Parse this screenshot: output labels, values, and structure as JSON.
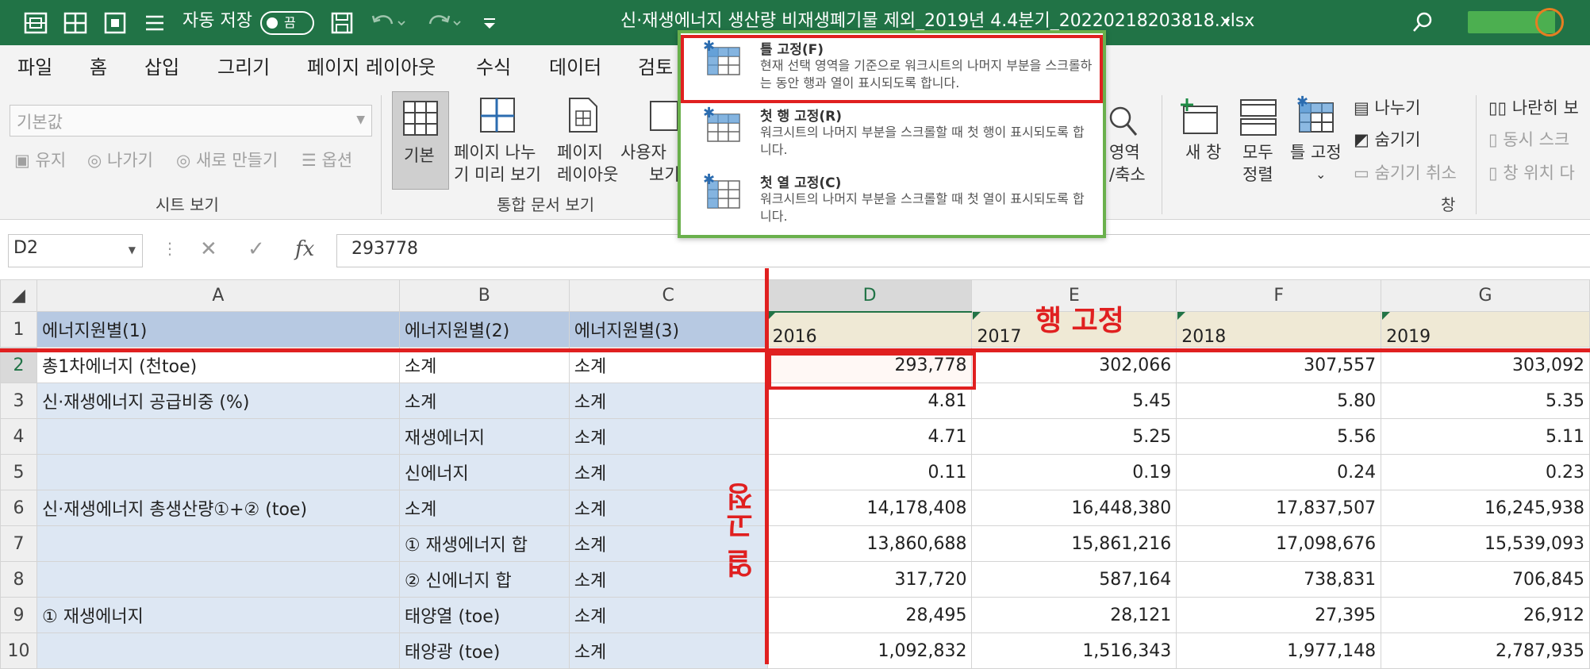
{
  "titlebar": {
    "autosave_label": "자동 저장",
    "autosave_state": "끔",
    "filename": "신·재생에너지 생산량 비재생폐기물 제외_2019년 4.4분기_20220218203818.xlsx",
    "filename_chevron": "▾"
  },
  "menu": [
    "파일",
    "홈",
    "삽입",
    "그리기",
    "페이지 레이아웃",
    "수식",
    "데이터",
    "검토"
  ],
  "ribbon": {
    "sheet_view": {
      "select_value": "기본값",
      "keep": "유지",
      "exit": "나가기",
      "new": "새로 만들기",
      "options": "옵션",
      "group": "시트 보기"
    },
    "workbook_views": {
      "normal": "기본",
      "page_break_line1": "페이지 나누",
      "page_break_line2": "기 미리 보기",
      "page_layout_line1": "페이지",
      "page_layout_line2": "레이아웃",
      "custom_line1": "사용자",
      "custom_line2": "보기",
      "group": "통합 문서 보기"
    },
    "zoom": {
      "line1": "영역",
      "line2": "/축소"
    },
    "window": {
      "new_window": "새 창",
      "arrange_line1": "모두",
      "arrange_line2": "정렬",
      "freeze": "틀 고정",
      "freeze_chevron": "⌄",
      "split": "나누기",
      "hide": "숨기기",
      "unhide": "숨기기 취소",
      "side_by_side": "나란히 보",
      "sync_scroll": "동시 스크",
      "reset_position": "창 위치 다",
      "group": "창"
    }
  },
  "freeze_menu": [
    {
      "title": "틀 고정(F)",
      "desc": "현재 선택 영역을 기준으로 워크시트의 나머지 부분을 스크롤하는 동안 행과 열이 표시되도록 합니다."
    },
    {
      "title": "첫 행 고정(R)",
      "desc": "워크시트의 나머지 부분을 스크롤할 때 첫 행이 표시되도록 합니다."
    },
    {
      "title": "첫 열 고정(C)",
      "desc": "워크시트의 나머지 부분을 스크롤할 때 첫 열이 표시되도록 합니다."
    }
  ],
  "formula_bar": {
    "name_box": "D2",
    "formula": "293778",
    "fx": "fx"
  },
  "sheet": {
    "columns": [
      "A",
      "B",
      "C",
      "D",
      "E",
      "F",
      "G"
    ],
    "rows": [
      [
        "1",
        "에너지원별(1)",
        "에너지원별(2)",
        "에너지원별(3)",
        "2016",
        "2017",
        "2018",
        "2019"
      ],
      [
        "2",
        "총1차에너지 (천toe)",
        "소계",
        "소계",
        "293,778",
        "302,066",
        "307,557",
        "303,092"
      ],
      [
        "3",
        "신·재생에너지 공급비중 (%)",
        "소계",
        "소계",
        "4.81",
        "5.45",
        "5.80",
        "5.35"
      ],
      [
        "4",
        "",
        "재생에너지",
        "소계",
        "4.71",
        "5.25",
        "5.56",
        "5.11"
      ],
      [
        "5",
        "",
        "신에너지",
        "소계",
        "0.11",
        "0.19",
        "0.24",
        "0.23"
      ],
      [
        "6",
        "신·재생에너지 총생산량①+② (toe)",
        "소계",
        "소계",
        "14,178,408",
        "16,448,380",
        "17,837,507",
        "16,245,938"
      ],
      [
        "7",
        "",
        "① 재생에너지 합",
        "소계",
        "13,860,688",
        "15,861,216",
        "17,098,676",
        "15,539,093"
      ],
      [
        "8",
        "",
        "② 신에너지 합",
        "소계",
        "317,720",
        "587,164",
        "738,831",
        "706,845"
      ],
      [
        "9",
        "① 재생에너지",
        "태양열 (toe)",
        "소계",
        "28,495",
        "28,121",
        "27,395",
        "26,912"
      ],
      [
        "10",
        "",
        "태양광 (toe)",
        "소계",
        "1,092,832",
        "1,516,343",
        "1,977,148",
        "2,787,935"
      ]
    ]
  },
  "annotations": {
    "row_freeze": "행 고정",
    "col_freeze": "열 고정"
  },
  "colors": {
    "excel_green": "#217346",
    "annotation_red": "#e02020",
    "menu_border_green": "#6ab04c"
  }
}
